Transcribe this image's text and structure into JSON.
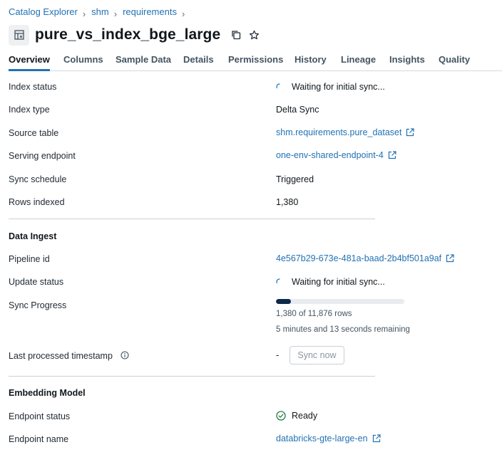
{
  "breadcrumb": {
    "items": [
      "Catalog Explorer",
      "shm",
      "requirements"
    ],
    "separator": "›"
  },
  "header": {
    "title": "pure_vs_index_bge_large",
    "icon": "vector-index-icon",
    "actions": [
      "copy-icon",
      "star-icon"
    ]
  },
  "tabs": [
    "Overview",
    "Columns",
    "Sample Data",
    "Details",
    "Permissions",
    "History",
    "Lineage",
    "Insights",
    "Quality"
  ],
  "active_tab": "Overview",
  "overview": {
    "index_status": {
      "label": "Index status",
      "value": "Waiting for initial sync..."
    },
    "index_type": {
      "label": "Index type",
      "value": "Delta Sync"
    },
    "source_table": {
      "label": "Source table",
      "value": "shm.requirements.pure_dataset"
    },
    "serving_endpoint": {
      "label": "Serving endpoint",
      "value": "one-env-shared-endpoint-4"
    },
    "sync_schedule": {
      "label": "Sync schedule",
      "value": "Triggered"
    },
    "rows_indexed": {
      "label": "Rows indexed",
      "value": "1,380"
    }
  },
  "data_ingest": {
    "title": "Data Ingest",
    "pipeline_id": {
      "label": "Pipeline id",
      "value": "4e567b29-673e-481a-baad-2b4bf501a9af"
    },
    "update_status": {
      "label": "Update status",
      "value": "Waiting for initial sync..."
    },
    "sync_progress": {
      "label": "Sync Progress",
      "fraction": 0.116,
      "rows_text": "1,380 of 11,876 rows",
      "remaining_text": "5 minutes and 13 seconds remaining"
    },
    "last_processed": {
      "label": "Last processed timestamp",
      "value": "-",
      "button": "Sync now"
    }
  },
  "embedding_model": {
    "title": "Embedding Model",
    "endpoint_status": {
      "label": "Endpoint status",
      "value": "Ready"
    },
    "endpoint_name": {
      "label": "Endpoint name",
      "value": "databricks-gte-large-en"
    }
  },
  "colors": {
    "link": "#2272b4",
    "progress": "#0b2a4a",
    "ready": "#277c43",
    "tab_indicator": "#2272b4"
  }
}
